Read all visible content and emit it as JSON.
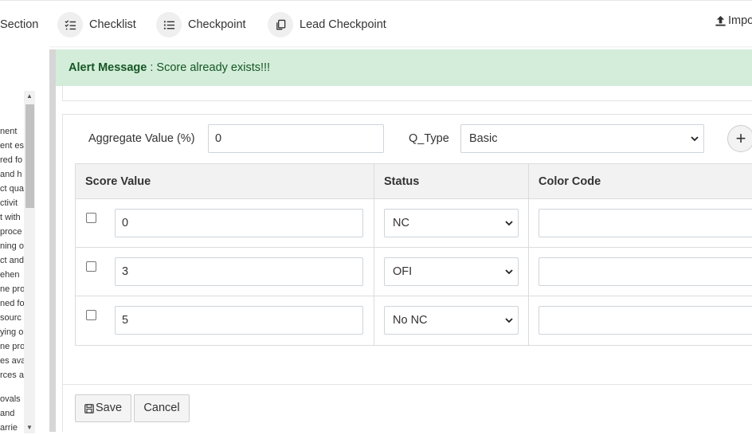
{
  "nav": {
    "section_label": "Section",
    "checklist_label": "Checklist",
    "checkpoint_label": "Checkpoint",
    "lead_checkpoint_label": "Lead Checkpoint",
    "import_label": "Impo"
  },
  "sidebar": {
    "lines": [
      "nent",
      "ent es",
      "red fo",
      "and h",
      "ct qua",
      "ctivit",
      "t with",
      "proce",
      "ning o",
      "ct and",
      "ehen",
      "ne pro",
      "ned fo",
      "sourc",
      "ying o",
      "ne pro",
      "es ava",
      "rces a",
      "ovals",
      "and",
      "arrie"
    ],
    "status_colors": [
      "#0e8a16",
      "#f2f200",
      "#e8000b"
    ]
  },
  "alert": {
    "title": "Alert Message",
    "message": " : Score already exists!!!"
  },
  "form": {
    "aggregate_label": "Aggregate Value (%)",
    "aggregate_value": "0",
    "qtype_label": "Q_Type",
    "qtype_value": "Basic",
    "add_symbol": "+"
  },
  "table": {
    "headers": [
      "Score Value",
      "Status",
      "Color Code"
    ],
    "rows": [
      {
        "score": "0",
        "status": "NC",
        "color": ""
      },
      {
        "score": "3",
        "status": "OFI",
        "color": ""
      },
      {
        "score": "5",
        "status": "No NC",
        "color": ""
      }
    ]
  },
  "buttons": {
    "save": "Save",
    "cancel": "Cancel"
  }
}
